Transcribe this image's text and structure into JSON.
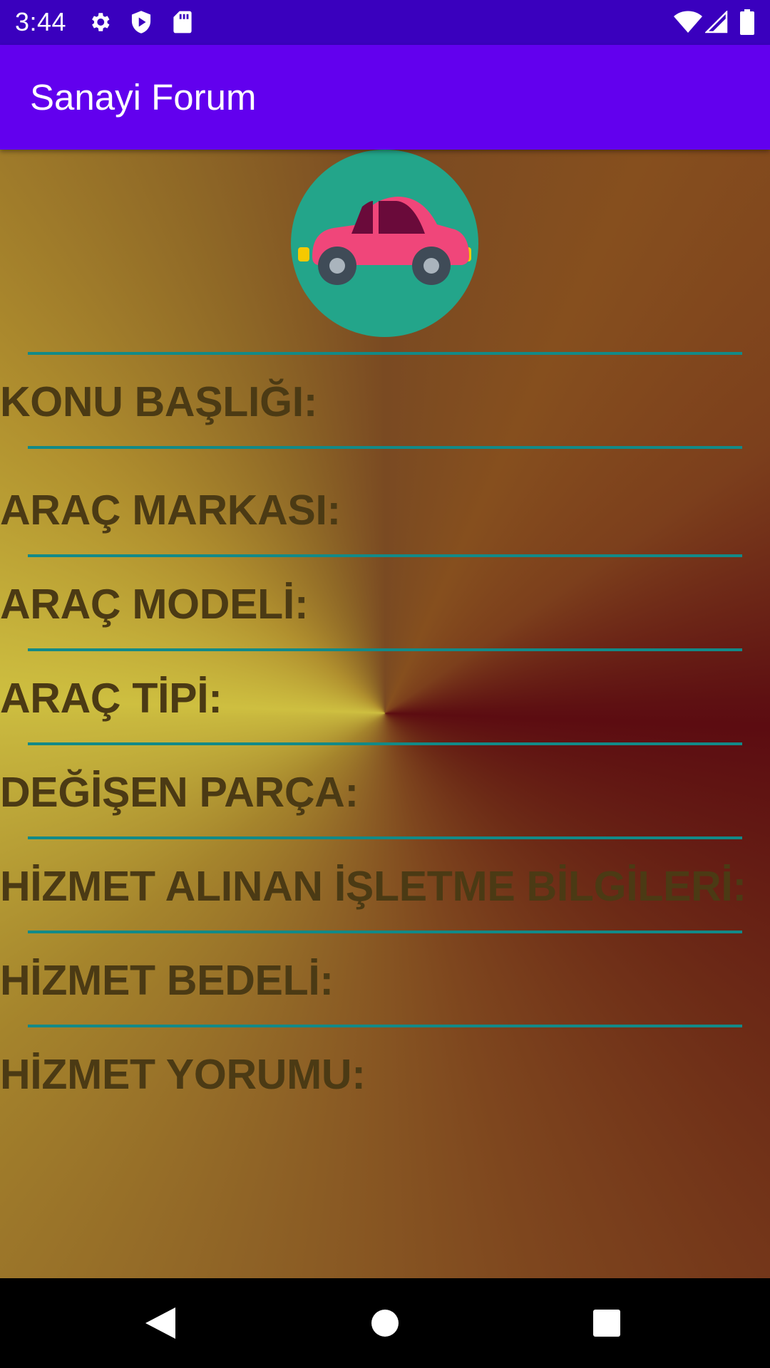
{
  "status_bar": {
    "time": "3:44",
    "left_icons": [
      "gear-icon",
      "shield-play-icon",
      "sd-card-icon"
    ],
    "right_icons": [
      "wifi-icon",
      "signal-icon",
      "battery-icon"
    ]
  },
  "app_bar": {
    "title": "Sanayi Forum",
    "color": "#6200ee"
  },
  "header_image": {
    "icon": "car-icon",
    "background": "#23a58a"
  },
  "form": {
    "fields": [
      {
        "label": "KONU BAŞLIĞI:"
      },
      {
        "label": "ARAÇ MARKASI:"
      },
      {
        "label": "ARAÇ MODELİ:"
      },
      {
        "label": "ARAÇ TİPİ:"
      },
      {
        "label": "DEĞİŞEN PARÇA:"
      },
      {
        "label": "HİZMET ALINAN İŞLETME BİLGİLERİ:"
      },
      {
        "label": "HİZMET BEDELİ:"
      },
      {
        "label": "HİZMET YORUMU:"
      }
    ],
    "divider_color": "#128a88",
    "label_color": "#4b3a14"
  },
  "nav_bar": {
    "buttons": [
      "back-icon",
      "home-icon",
      "recents-icon"
    ]
  }
}
